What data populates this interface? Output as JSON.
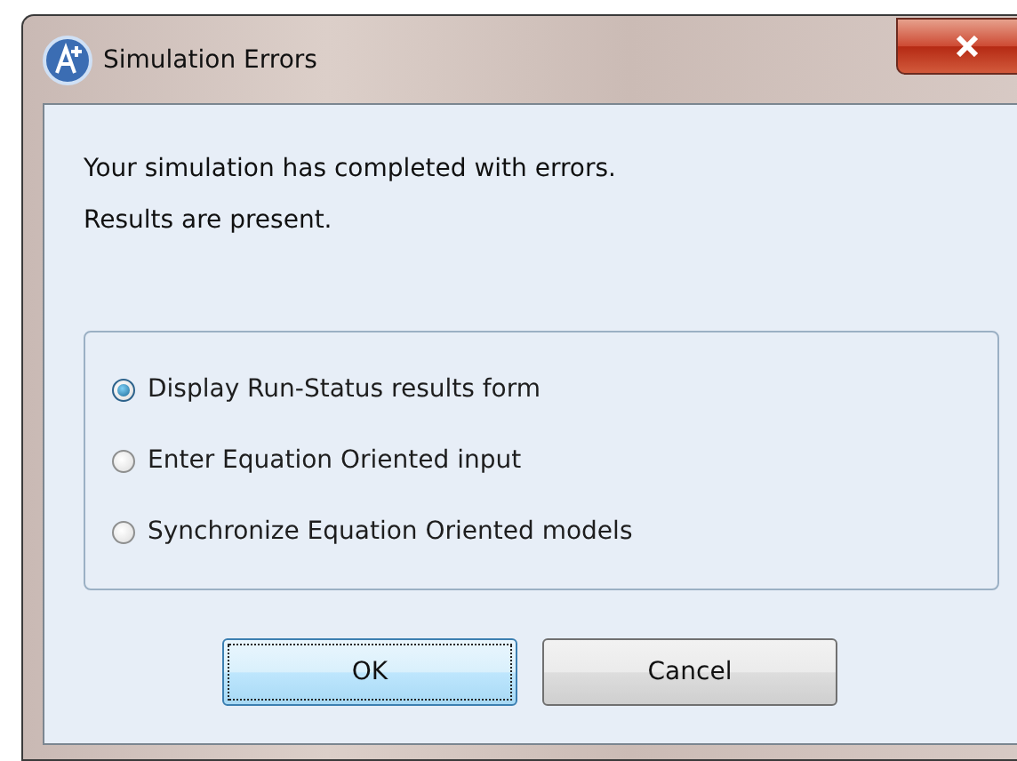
{
  "window": {
    "title": "Simulation Errors"
  },
  "message": [
    "Your simulation has completed with errors.",
    "Results are present."
  ],
  "options": [
    {
      "label": "Display Run-Status results form",
      "selected": true
    },
    {
      "label": "Enter Equation Oriented input",
      "selected": false
    },
    {
      "label": "Synchronize Equation Oriented models",
      "selected": false
    }
  ],
  "buttons": [
    {
      "label": "OK",
      "default": true
    },
    {
      "label": "Cancel",
      "default": false
    }
  ]
}
